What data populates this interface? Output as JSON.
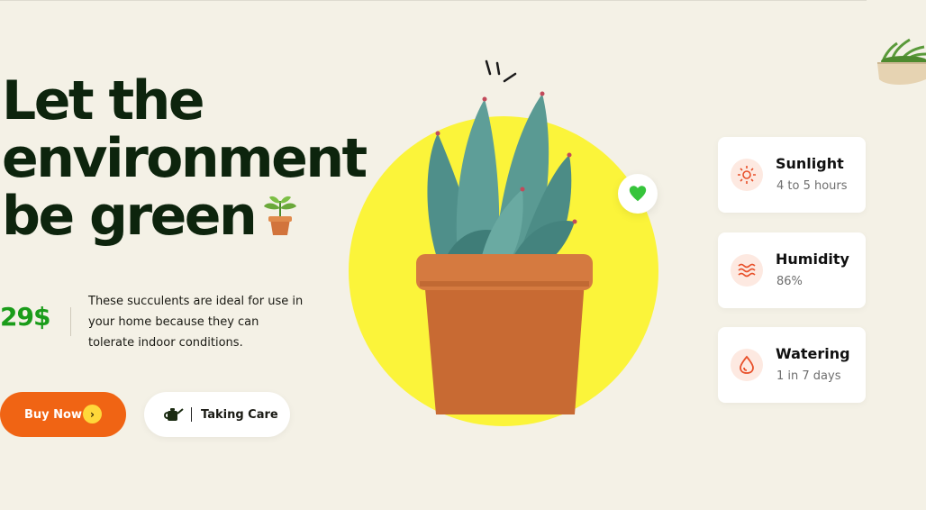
{
  "hero": {
    "headline_lines": [
      "Let the",
      "environment",
      "be green"
    ],
    "price": "29$",
    "description": "These succulents are ideal for use in your home because they can tolerate indoor conditions."
  },
  "actions": {
    "buy_label": "Buy Now",
    "buy_arrow": "›",
    "care_label": "Taking Care"
  },
  "cards": [
    {
      "title": "Sunlight",
      "value": "4 to 5 hours",
      "icon": "sun-icon"
    },
    {
      "title": "Humidity",
      "value": "86%",
      "icon": "waves-icon"
    },
    {
      "title": "Watering",
      "value": "1 in 7 days",
      "icon": "water-drop-icon"
    }
  ],
  "colors": {
    "background": "#f4f1e6",
    "accent_orange": "#f06414",
    "price_green": "#1a9c1a",
    "sun_yellow": "#fbf43a",
    "icon_red": "#e8502a"
  }
}
